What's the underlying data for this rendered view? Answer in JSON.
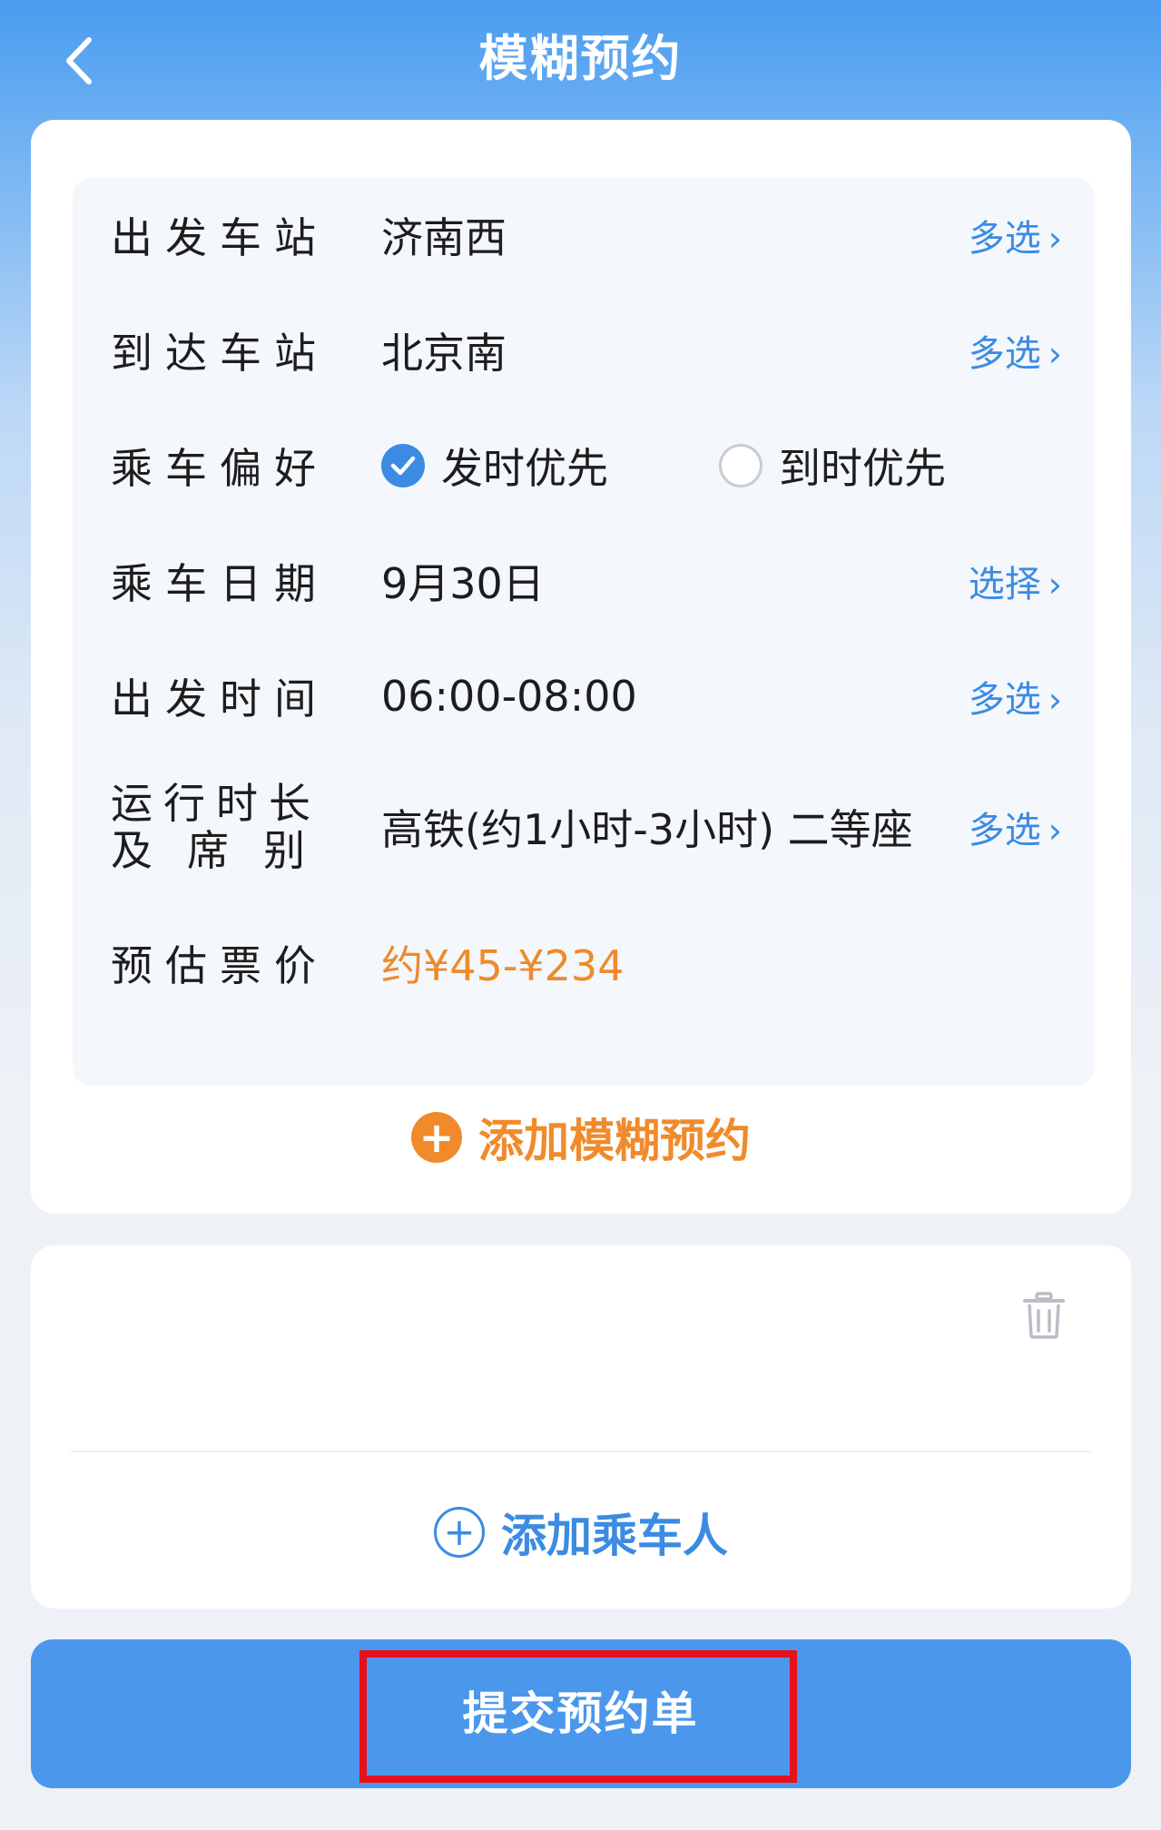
{
  "header": {
    "title": "模糊预约",
    "back_icon": "chevron-left-icon"
  },
  "form": {
    "departure": {
      "label": "出发车站",
      "value": "济南西",
      "action": "多选"
    },
    "arrival": {
      "label": "到达车站",
      "value": "北京南",
      "action": "多选"
    },
    "preference": {
      "label": "乘车偏好",
      "options": [
        {
          "label": "发时优先",
          "selected": true
        },
        {
          "label": "到时优先",
          "selected": false
        }
      ]
    },
    "date": {
      "label": "乘车日期",
      "value": "9月30日",
      "action": "选择"
    },
    "depart_time": {
      "label": "出发时间",
      "value": "06:00-08:00",
      "action": "多选"
    },
    "duration": {
      "label_line1": "运行时长",
      "label_line2": "及席别",
      "value": "高铁(约1小时-3小时) 二等座",
      "action": "多选"
    },
    "price": {
      "label": "预估票价",
      "value": "约¥45-¥234"
    },
    "chevron": "›"
  },
  "add_reservation": {
    "label": "添加模糊预约",
    "icon": "plus-circle-filled-icon"
  },
  "passengers": {
    "delete_icon": "trash-icon",
    "add_label": "添加乘车人",
    "add_icon": "plus-circle-outline-icon"
  },
  "submit": {
    "label": "提交预约单"
  },
  "colors": {
    "primary": "#3b8be2",
    "accent_orange": "#f08a2b",
    "highlight": "#e8101a"
  }
}
